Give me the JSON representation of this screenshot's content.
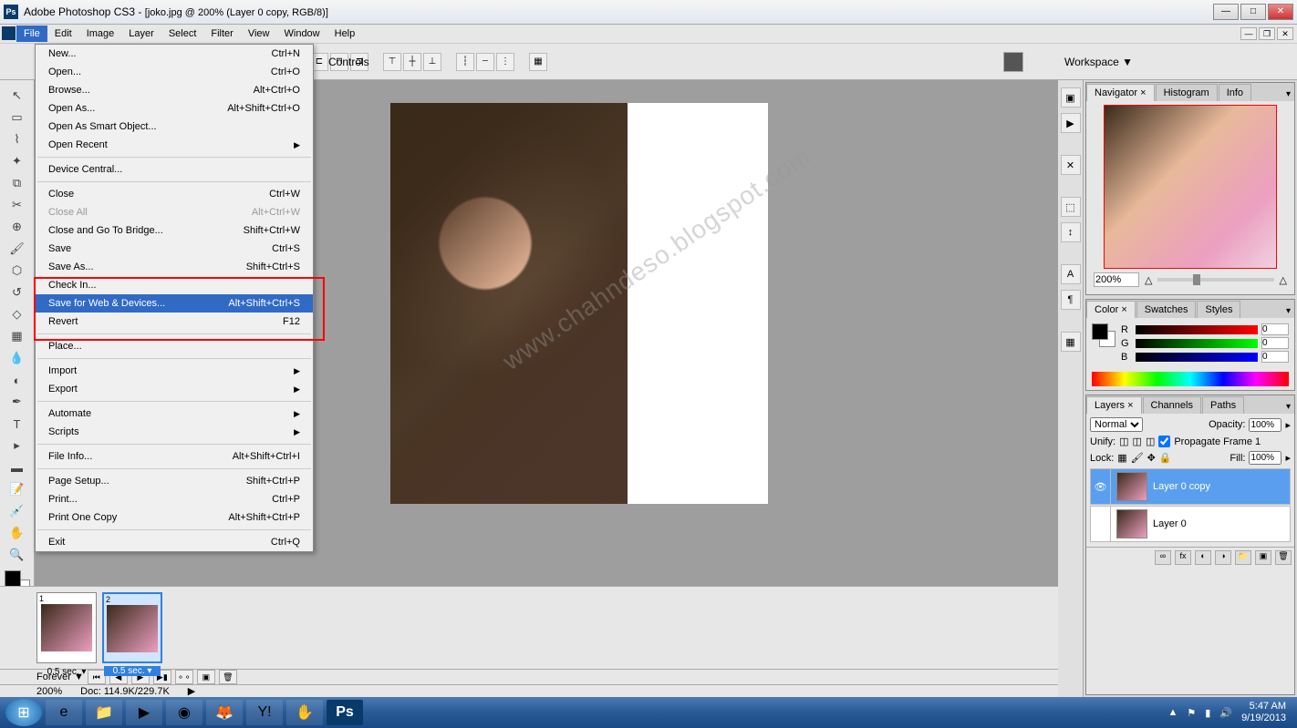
{
  "titlebar": {
    "app": "Adobe Photoshop CS3",
    "doc": "[joko.jpg @ 200% (Layer 0 copy, RGB/8)]"
  },
  "menubar": [
    "File",
    "Edit",
    "Image",
    "Layer",
    "Select",
    "Filter",
    "View",
    "Window",
    "Help"
  ],
  "open_menu_index": 0,
  "file_menu": [
    {
      "t": "item",
      "label": "New...",
      "sc": "Ctrl+N"
    },
    {
      "t": "item",
      "label": "Open...",
      "sc": "Ctrl+O"
    },
    {
      "t": "item",
      "label": "Browse...",
      "sc": "Alt+Ctrl+O"
    },
    {
      "t": "item",
      "label": "Open As...",
      "sc": "Alt+Shift+Ctrl+O"
    },
    {
      "t": "item",
      "label": "Open As Smart Object..."
    },
    {
      "t": "sub",
      "label": "Open Recent"
    },
    {
      "t": "sep"
    },
    {
      "t": "item",
      "label": "Device Central..."
    },
    {
      "t": "sep"
    },
    {
      "t": "item",
      "label": "Close",
      "sc": "Ctrl+W"
    },
    {
      "t": "item",
      "label": "Close All",
      "sc": "Alt+Ctrl+W",
      "disabled": true
    },
    {
      "t": "item",
      "label": "Close and Go To Bridge...",
      "sc": "Shift+Ctrl+W"
    },
    {
      "t": "item",
      "label": "Save",
      "sc": "Ctrl+S"
    },
    {
      "t": "item",
      "label": "Save As...",
      "sc": "Shift+Ctrl+S"
    },
    {
      "t": "item",
      "label": "Check In..."
    },
    {
      "t": "item",
      "label": "Save for Web & Devices...",
      "sc": "Alt+Shift+Ctrl+S",
      "hl": true
    },
    {
      "t": "item",
      "label": "Revert",
      "sc": "F12"
    },
    {
      "t": "sep"
    },
    {
      "t": "item",
      "label": "Place..."
    },
    {
      "t": "sep"
    },
    {
      "t": "sub",
      "label": "Import"
    },
    {
      "t": "sub",
      "label": "Export"
    },
    {
      "t": "sep"
    },
    {
      "t": "sub",
      "label": "Automate"
    },
    {
      "t": "sub",
      "label": "Scripts"
    },
    {
      "t": "sep"
    },
    {
      "t": "item",
      "label": "File Info...",
      "sc": "Alt+Shift+Ctrl+I"
    },
    {
      "t": "sep"
    },
    {
      "t": "item",
      "label": "Page Setup...",
      "sc": "Shift+Ctrl+P"
    },
    {
      "t": "item",
      "label": "Print...",
      "sc": "Ctrl+P"
    },
    {
      "t": "item",
      "label": "Print One Copy",
      "sc": "Alt+Shift+Ctrl+P"
    },
    {
      "t": "sep"
    },
    {
      "t": "item",
      "label": "Exit",
      "sc": "Ctrl+Q"
    }
  ],
  "optionsbar": {
    "controls_label": "Controls",
    "workspace": "Workspace ▼"
  },
  "watermark": "www.chahndeso.blogspot.com",
  "navigator": {
    "tabs": [
      "Navigator ×",
      "Histogram",
      "Info"
    ],
    "zoom": "200%"
  },
  "color": {
    "tabs": [
      "Color ×",
      "Swatches",
      "Styles"
    ],
    "r": "0",
    "g": "0",
    "b": "0"
  },
  "layers": {
    "tabs": [
      "Layers ×",
      "Channels",
      "Paths"
    ],
    "blend": "Normal",
    "opacity_label": "Opacity:",
    "opacity": "100%",
    "unify": "Unify:",
    "propagate": "Propagate Frame 1",
    "lock": "Lock:",
    "fill_label": "Fill:",
    "fill": "100%",
    "items": [
      {
        "name": "Layer 0 copy",
        "sel": true
      },
      {
        "name": "Layer 0",
        "sel": false
      }
    ],
    "fx_label": "fx"
  },
  "animation": {
    "frames": [
      {
        "n": "1",
        "delay": "0.5 sec."
      },
      {
        "n": "2",
        "delay": "0.5 sec."
      }
    ],
    "selected": 1,
    "loop": "Forever ▼"
  },
  "status": {
    "zoom": "200%",
    "doc": "Doc: 114.9K/229.7K"
  },
  "taskbar": {
    "time": "5:47 AM",
    "date": "9/19/2013"
  }
}
